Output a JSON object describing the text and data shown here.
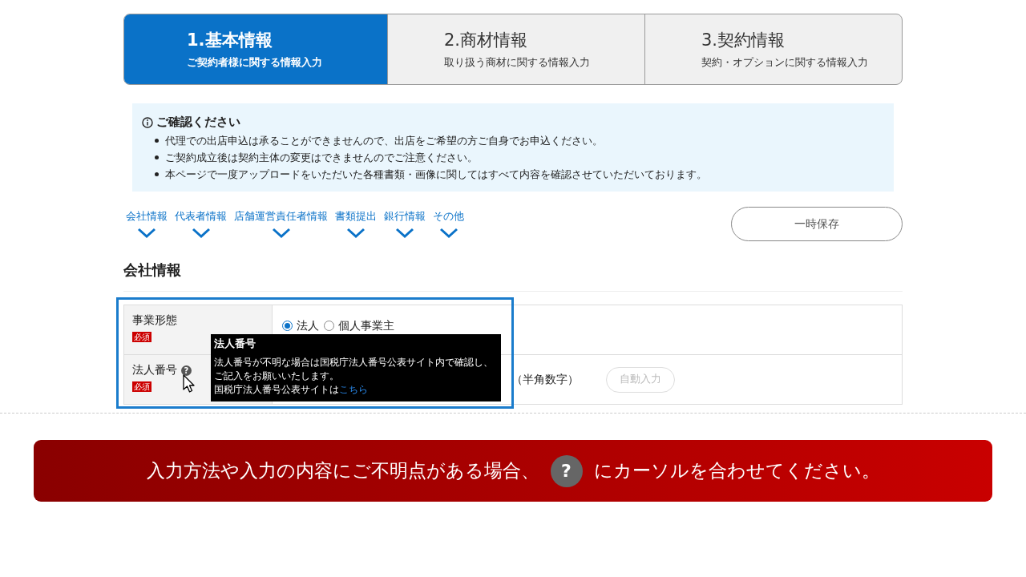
{
  "steps": [
    {
      "title": "1.基本情報",
      "subtitle": "ご契約者様に関する情報入力",
      "selected": true
    },
    {
      "title": "2.商材情報",
      "subtitle": "取り扱う商材に関する情報入力",
      "selected": false
    },
    {
      "title": "3.契約情報",
      "subtitle": "契約・オプションに関する情報入力",
      "selected": false
    }
  ],
  "notice": {
    "title": "ご確認ください",
    "items": [
      "代理での出店申込は承ることができませんので、出店をご希望の方ご自身でお申込ください。",
      "ご契約成立後は契約主体の変更はできませんのでご注意ください。",
      "本ページで一度アップロードをいただいた各種書類・画像に関してはすべて内容を確認させていただいております。"
    ]
  },
  "section_links": [
    "会社情報",
    "代表者情報",
    "店舗運営責任者情報",
    "書類提出",
    "銀行情報",
    "その他"
  ],
  "save_button": "一時保存",
  "section_title": "会社情報",
  "form_rows": [
    {
      "kind": "radio",
      "label": "事業形態",
      "required": "必須",
      "options": [
        {
          "label": "法人",
          "selected": true
        },
        {
          "label": "個人事業主",
          "selected": false
        }
      ]
    },
    {
      "kind": "number",
      "label": "法人番号",
      "required": "必須",
      "help": true,
      "note": "（半角数字）",
      "button": "自動入力"
    }
  ],
  "tooltip": {
    "title": "法人番号",
    "lines": [
      "法人番号が不明な場合は国税庁法人番号公表サイト内で確認し、",
      "ご記入をお願いいたします。"
    ],
    "link_prefix": "国税庁法人番号公表サイトは",
    "link": "こちら"
  },
  "banner": {
    "before": "入力方法や入力の内容にご不明点がある場合、",
    "icon": "?",
    "after": "にカーソルを合わせてください。"
  }
}
